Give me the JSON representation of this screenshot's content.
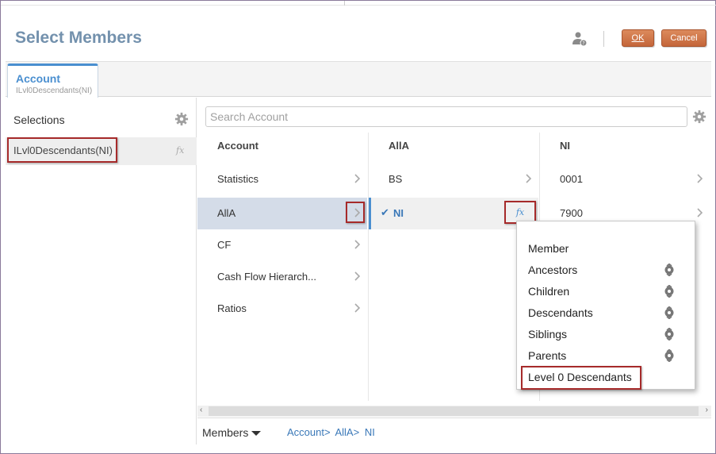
{
  "header": {
    "title": "Select Members",
    "ok_label": "OK",
    "cancel_label": "Cancel"
  },
  "tab": {
    "title": "Account",
    "subtitle": "ILvl0Descendants(NI)"
  },
  "selections": {
    "label": "Selections",
    "item": "ILvl0Descendants(NI)",
    "fx": "fx"
  },
  "search": {
    "placeholder": "Search Account"
  },
  "columns": [
    {
      "header": "Account",
      "rows": [
        "Statistics",
        "AllA",
        "CF",
        "Cash Flow Hierarch...",
        "Ratios"
      ]
    },
    {
      "header": "AllA",
      "rows": [
        "BS",
        "NI"
      ]
    },
    {
      "header": "NI",
      "rows": [
        "0001",
        "7900"
      ]
    }
  ],
  "fx_label": "fx",
  "check_mark": "✔",
  "footer": {
    "members_label": "Members",
    "breadcrumb": [
      "Account>",
      "AllA>",
      "NI"
    ]
  },
  "popup": {
    "items": [
      "Member",
      "Ancestors",
      "Children",
      "Descendants",
      "Siblings",
      "Parents",
      "Level 0 Descendants"
    ]
  },
  "colors": {
    "accent": "#4a8fd0",
    "title": "#7391ad",
    "button": "#c4663a",
    "highlight_box": "#a62a2a"
  }
}
